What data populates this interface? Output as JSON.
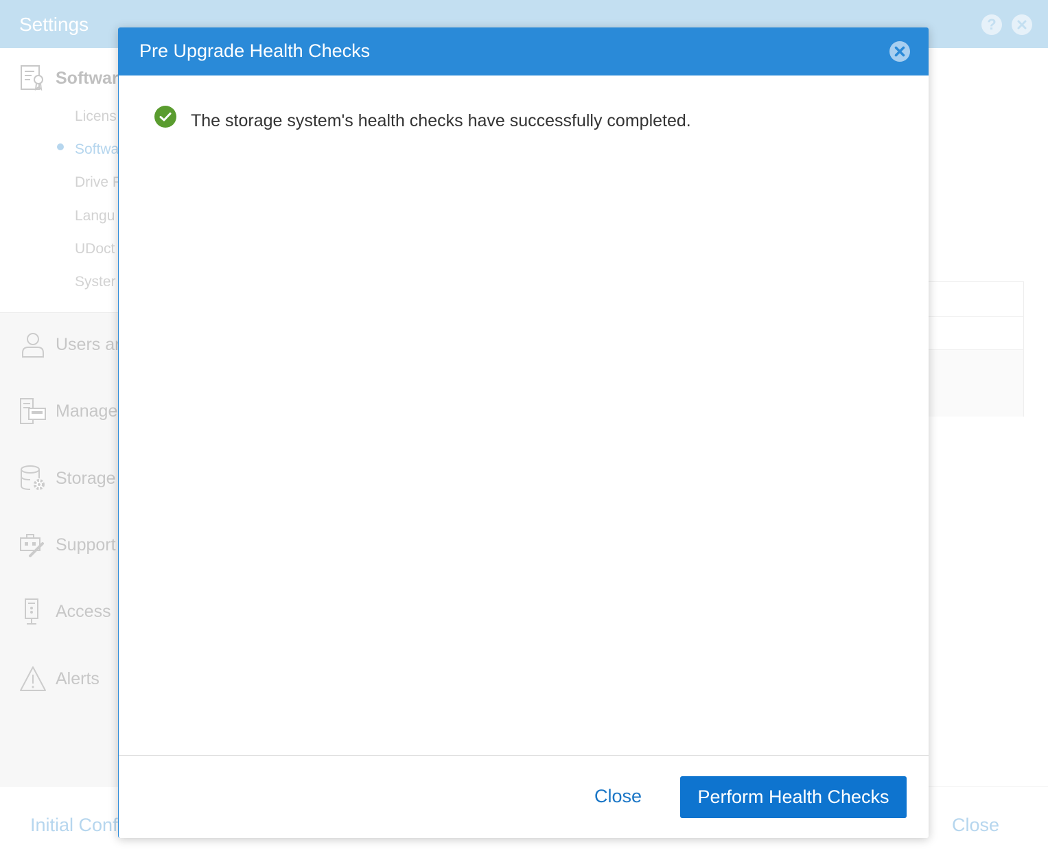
{
  "settings": {
    "title": "Settings",
    "help_icon": "help-icon",
    "close_icon": "close-icon",
    "nav": {
      "items": [
        {
          "label": "Softwar",
          "icon": "software-certificate-icon"
        },
        {
          "label": "Users ar",
          "icon": "user-icon"
        },
        {
          "label": "Manage",
          "icon": "management-icon"
        },
        {
          "label": "Storage",
          "icon": "storage-gear-icon"
        },
        {
          "label": "Support",
          "icon": "support-tools-icon"
        },
        {
          "label": "Access",
          "icon": "access-device-icon"
        },
        {
          "label": "Alerts",
          "icon": "alert-warning-icon"
        }
      ],
      "sub_items": [
        "Licens",
        "Softwa",
        "Drive F",
        "Langu",
        "UDoct",
        "Syster"
      ]
    },
    "footer": {
      "left_link": "Initial Conf",
      "close_label": "Close"
    }
  },
  "modal": {
    "title": "Pre Upgrade Health Checks",
    "status_icon": "check-circle-icon",
    "status_color": "#5a9c2f",
    "message": "The storage system's health checks have successfully completed.",
    "close_label": "Close",
    "primary_label": "Perform Health Checks",
    "accent_color": "#2a8ad8"
  }
}
